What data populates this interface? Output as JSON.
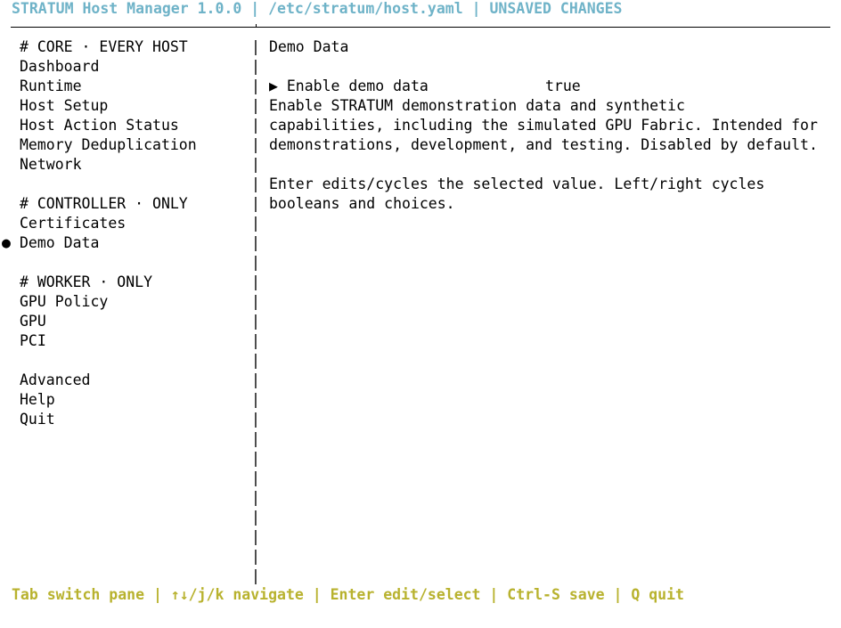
{
  "title": {
    "app": "STRATUM Host Manager 1.0.0",
    "sep1": " | ",
    "path": "/etc/stratum/host.yaml",
    "sep2": " | ",
    "status": "UNSAVED CHANGES"
  },
  "colors": {
    "title": "#6fb3c8",
    "footer": "#b8b22e",
    "text": "#000000",
    "background": "#ffffff"
  },
  "sidebar": {
    "selected_marker": "●",
    "sections": [
      {
        "header": "# CORE · EVERY HOST",
        "items": [
          "Dashboard",
          "Runtime",
          "Host Setup",
          "Host Action Status",
          "Memory Deduplication",
          "Network"
        ]
      },
      {
        "header": "# CONTROLLER · ONLY",
        "items": [
          "Certificates",
          "Demo Data"
        ]
      },
      {
        "header": "# WORKER · ONLY",
        "items": [
          "GPU Policy",
          "GPU",
          "PCI"
        ]
      },
      {
        "header": "",
        "items": [
          "Advanced",
          "Help",
          "Quit"
        ]
      }
    ],
    "selected_item": "Demo Data"
  },
  "divider_char": "|",
  "detail": {
    "heading": "Demo Data",
    "setting": {
      "marker": "▶",
      "label": "Enable demo data",
      "value": "true"
    },
    "description": [
      "Enable STRATUM demonstration data and synthetic",
      "capabilities, including the simulated GPU Fabric. Intended for",
      "demonstrations, development, and testing. Disabled by default."
    ],
    "hint": [
      "Enter edits/cycles the selected value. Left/right cycles",
      "booleans and choices."
    ]
  },
  "footer": {
    "keys": "Tab switch pane | ↑↓/j/k navigate | Enter edit/select | Ctrl-S save | Q quit"
  }
}
